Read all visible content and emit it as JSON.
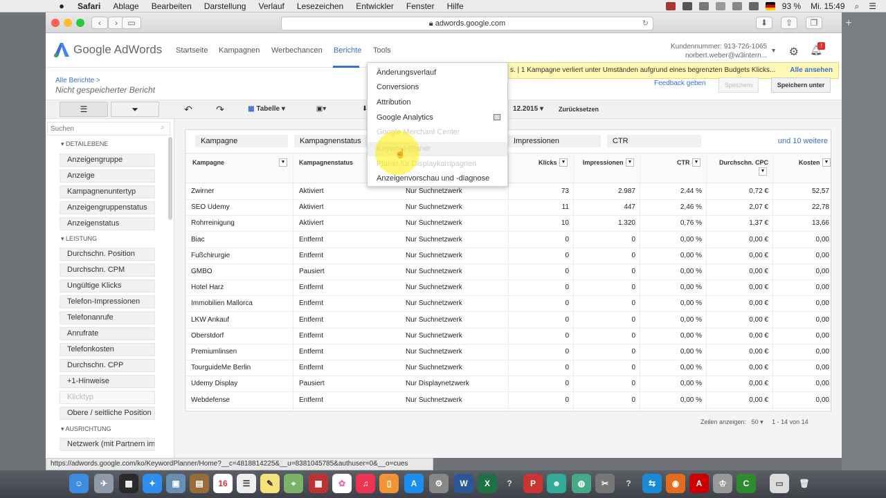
{
  "menubar": {
    "app": "Safari",
    "items": [
      "Ablage",
      "Bearbeiten",
      "Darstellung",
      "Verlauf",
      "Lesezeichen",
      "Entwickler",
      "Fenster",
      "Hilfe"
    ],
    "battery": "93 %",
    "clock": "Mi. 15:49"
  },
  "browser": {
    "url": "adwords.google.com",
    "status_url": "https://adwords.google.com/ko/KeywordPlanner/Home?__c=4818814225&__u=8381045785&authuser=0&__o=cues"
  },
  "header": {
    "logo_text": "Google AdWords",
    "nav": [
      "Startseite",
      "Kampagnen",
      "Werbechancen",
      "Berichte",
      "Tools"
    ],
    "account_line1": "Kundennummer: 913-726-1065",
    "account_line2": "norbert.weber@w3intern...",
    "bell_badge": "!"
  },
  "breadcrumb": {
    "parent": "Alle Berichte >",
    "current": "Nicht gespeicherter Bericht"
  },
  "notice": {
    "text": "s.  |  1 Kampagne verliert unter Umständen aufgrund eines begrenzten Budgets Klicks...",
    "link": "Alle ansehen"
  },
  "actions": {
    "feedback": "Feedback geben",
    "save": "Speichern",
    "save_under": "Speichern unter"
  },
  "toolbar": {
    "view": "Tabelle",
    "date_suffix": "12.2015",
    "reset": "Zurücksetzen"
  },
  "sidebar": {
    "search_placeholder": "Suchen",
    "sections": [
      {
        "title": "DETAILEBENE",
        "items": [
          "Anzeigengruppe",
          "Anzeige",
          "Kampagnenuntertyp",
          "Anzeigengruppenstatus",
          "Anzeigenstatus"
        ]
      },
      {
        "title": "LEISTUNG",
        "items": [
          "Durchschn. Position",
          "Durchschn. CPM",
          "Ungültige Klicks",
          "Telefon-Impressionen",
          "Telefonanrufe",
          "Anrufrate",
          "Telefonkosten",
          "Durchschn. CPP",
          "+1-Hinweise",
          "Klicktyp",
          "Obere / seitliche Position"
        ]
      },
      {
        "title": "AUSRICHTUNG",
        "items": [
          "Netzwerk (mit Partnern im S"
        ]
      }
    ]
  },
  "filters": [
    "Kampagne",
    "Kampagnenstatus",
    "Impressionen",
    "CTR"
  ],
  "filters_more": "und 10 weitere",
  "table": {
    "columns": [
      "Kampagne",
      "Kampagnenstatus",
      "Klicks",
      "Impressionen",
      "CTR",
      "Durchschn. CPC",
      "Kosten"
    ],
    "rows": [
      [
        "Zwirner",
        "Aktiviert",
        "Nur Suchnetzwerk",
        "73",
        "2.987",
        "2,44 %",
        "0,72 €",
        "52,57"
      ],
      [
        "SEO Udemy",
        "Aktiviert",
        "Nur Suchnetzwerk",
        "11",
        "447",
        "2,46 %",
        "2,07 €",
        "22,78"
      ],
      [
        "Rohrreinigung",
        "Aktiviert",
        "Nur Suchnetzwerk",
        "10",
        "1.320",
        "0,76 %",
        "1,37 €",
        "13,66"
      ],
      [
        "Biac",
        "Entfernt",
        "Nur Suchnetzwerk",
        "0",
        "0",
        "0,00 %",
        "0,00 €",
        "0,00"
      ],
      [
        "Fußchirurgie",
        "Entfernt",
        "Nur Suchnetzwerk",
        "0",
        "0",
        "0,00 %",
        "0,00 €",
        "0,00"
      ],
      [
        "GMBO",
        "Pausiert",
        "Nur Suchnetzwerk",
        "0",
        "0",
        "0,00 %",
        "0,00 €",
        "0,00"
      ],
      [
        "Hotel Harz",
        "Entfernt",
        "Nur Suchnetzwerk",
        "0",
        "0",
        "0,00 %",
        "0,00 €",
        "0,00"
      ],
      [
        "Immobilien Mallorca",
        "Entfernt",
        "Nur Suchnetzwerk",
        "0",
        "0",
        "0,00 %",
        "0,00 €",
        "0,00"
      ],
      [
        "LKW Ankauf",
        "Entfernt",
        "Nur Suchnetzwerk",
        "0",
        "0",
        "0,00 %",
        "0,00 €",
        "0,00"
      ],
      [
        "Oberstdorf",
        "Entfernt",
        "Nur Suchnetzwerk",
        "0",
        "0",
        "0,00 %",
        "0,00 €",
        "0,00"
      ],
      [
        "Premiumlinsen",
        "Entfernt",
        "Nur Suchnetzwerk",
        "0",
        "0",
        "0,00 %",
        "0,00 €",
        "0,00"
      ],
      [
        "TourguideMe Berlin",
        "Entfernt",
        "Nur Suchnetzwerk",
        "0",
        "0",
        "0,00 %",
        "0,00 €",
        "0,00"
      ],
      [
        "Udemy Display",
        "Pausiert",
        "Nur Displaynetzwerk",
        "0",
        "0",
        "0,00 %",
        "0,00 €",
        "0,00"
      ],
      [
        "Webdefense",
        "Entfernt",
        "Nur Suchnetzwerk",
        "0",
        "0",
        "0,00 %",
        "0,00 €",
        "0,00"
      ]
    ]
  },
  "pager": {
    "label": "Zeilen anzeigen:",
    "size": "50",
    "range": "1 - 14 von 14"
  },
  "tools_menu": [
    "Änderungsverlauf",
    "Conversions",
    "Attribution",
    "Google Analytics",
    "Google Merchant Center",
    "Keyword-Planer",
    "Planer für Displaykampagnen",
    "Anzeigenvorschau und -diagnose"
  ],
  "colors": {
    "accent": "#3b6ed1",
    "notice_bg": "#fff8b5",
    "highlight": "#fff000"
  }
}
